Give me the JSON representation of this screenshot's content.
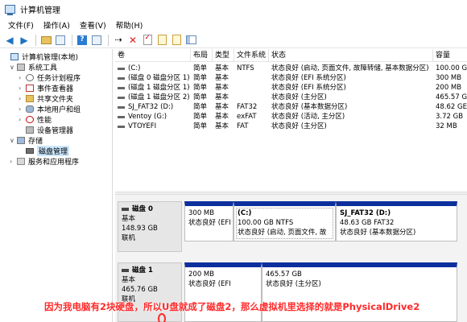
{
  "window": {
    "title": "计算机管理"
  },
  "menu": [
    "文件(F)",
    "操作(A)",
    "查看(V)",
    "帮助(H)"
  ],
  "toolbar_icons": [
    "back-icon",
    "forward-icon",
    "up-folder-icon",
    "console-tree-icon",
    "help-icon",
    "properties-icon",
    "connect-icon",
    "delete-icon",
    "check-icon",
    "open-icon",
    "new-icon",
    "show-pane-icon"
  ],
  "tree": [
    {
      "label": "计算机管理(本地)",
      "icon": "computer-icon",
      "arrow": ""
    },
    {
      "label": "系统工具",
      "icon": "tools-icon",
      "arrow": "∨"
    },
    {
      "label": "任务计划程序",
      "icon": "clock-icon",
      "arrow": "›"
    },
    {
      "label": "事件查看器",
      "icon": "event-icon",
      "arrow": "›"
    },
    {
      "label": "共享文件夹",
      "icon": "share-folder-icon",
      "arrow": "›"
    },
    {
      "label": "本地用户和组",
      "icon": "users-icon",
      "arrow": "›"
    },
    {
      "label": "性能",
      "icon": "performance-icon",
      "arrow": "›"
    },
    {
      "label": "设备管理器",
      "icon": "device-manager-icon",
      "arrow": ""
    },
    {
      "label": "存储",
      "icon": "storage-icon",
      "arrow": "∨"
    },
    {
      "label": "磁盘管理",
      "icon": "disk-icon",
      "arrow": ""
    },
    {
      "label": "服务和应用程序",
      "icon": "services-icon",
      "arrow": "›"
    }
  ],
  "volume_table": {
    "columns": [
      "卷",
      "布局",
      "类型",
      "文件系统",
      "状态",
      "容量"
    ],
    "rows": [
      [
        "(C:)",
        "简单",
        "基本",
        "NTFS",
        "状态良好 (启动, 页面文件, 故障转储, 基本数据分区)",
        "100.00 G"
      ],
      [
        "(磁盘 0 磁盘分区 1)",
        "简单",
        "基本",
        "",
        "状态良好 (EFI 系统分区)",
        "300 MB"
      ],
      [
        "(磁盘 1 磁盘分区 1)",
        "简单",
        "基本",
        "",
        "状态良好 (EFI 系统分区)",
        "200 MB"
      ],
      [
        "(磁盘 1 磁盘分区 2)",
        "简单",
        "基本",
        "",
        "状态良好 (主分区)",
        "465.57 G"
      ],
      [
        "SJ_FAT32 (D:)",
        "简单",
        "基本",
        "FAT32",
        "状态良好 (基本数据分区)",
        "48.62 GE"
      ],
      [
        "Ventoy (G:)",
        "简单",
        "基本",
        "exFAT",
        "状态良好 (活动, 主分区)",
        "3.72 GB"
      ],
      [
        "VTOYEFI",
        "简单",
        "基本",
        "FAT",
        "状态良好 (主分区)",
        "32 MB"
      ]
    ]
  },
  "disks": [
    {
      "name": "磁盘 0",
      "type": "基本",
      "size": "148.93 GB",
      "status": "联机",
      "partitions": [
        {
          "name": "",
          "size": "300 MB",
          "status": "状态良好 (EFI"
        },
        {
          "name": "(C:)",
          "size": "100.00 GB NTFS",
          "status": "状态良好 (启动, 页面文件, 故"
        },
        {
          "name": "SJ_FAT32  (D:)",
          "size": "48.63 GB FAT32",
          "status": "状态良好 (基本数据分区)"
        }
      ]
    },
    {
      "name": "磁盘 1",
      "type": "基本",
      "size": "465.76 GB",
      "status": "联机",
      "partitions": [
        {
          "name": "",
          "size": "200 MB",
          "status": "状态良好 (EFI"
        },
        {
          "name": "",
          "size": "465.57 GB",
          "status": "状态良好 (主分区)"
        }
      ]
    }
  ],
  "annotation": "因为我电脑有2块硬盘，所以U盘就成了磁盘2，那么虚拟机里选择的就是PhysicalDrive2",
  "colors": {
    "partition_header": "#0d2f9e",
    "annotation": "#ff2a2a",
    "selected": "#cce8ff"
  }
}
